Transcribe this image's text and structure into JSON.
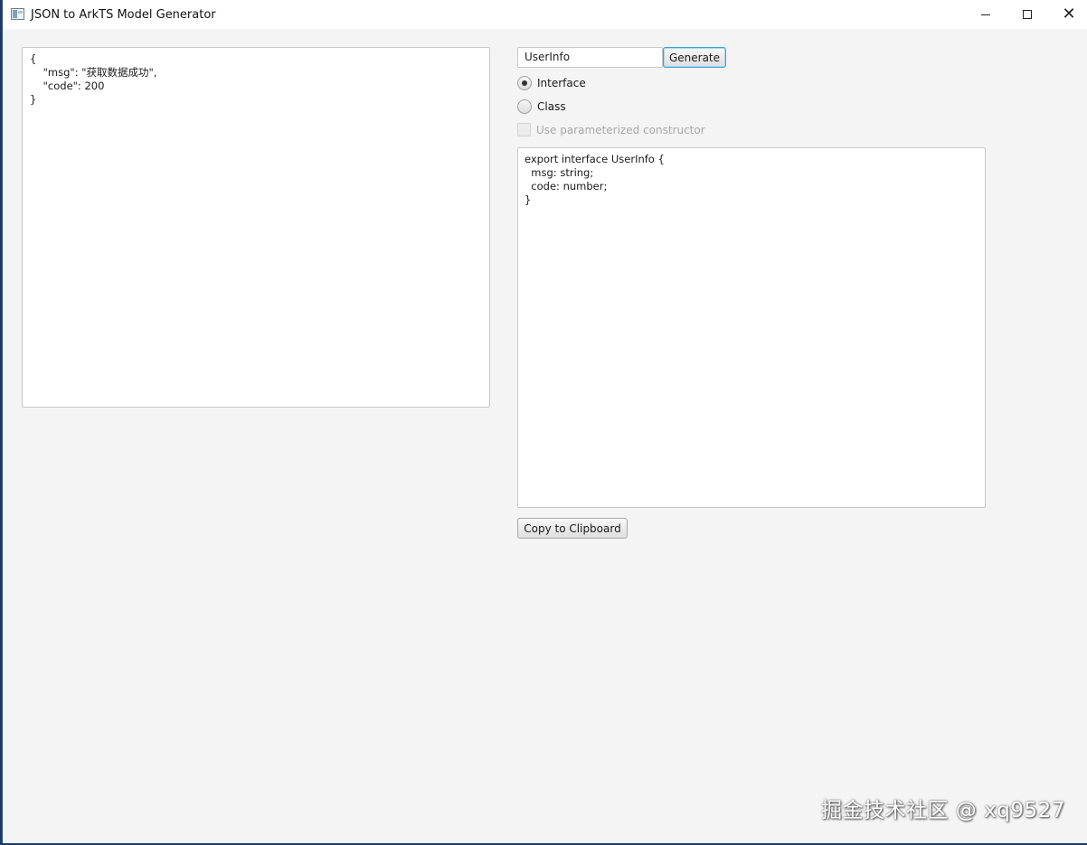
{
  "window": {
    "title": "JSON to ArkTS Model Generator",
    "icons": {
      "app": "app-window-icon",
      "minimize": "minimize-icon",
      "maximize": "maximize-icon",
      "close": "close-icon"
    },
    "close_glyph": "✕"
  },
  "json_input": {
    "value": "{\n    \"msg\": \"获取数据成功\",\n    \"code\": 200\n}"
  },
  "class_name_input": {
    "value": "UserInfo"
  },
  "generate_button": {
    "label": "Generate"
  },
  "type_options": [
    {
      "label": "Interface",
      "selected": true
    },
    {
      "label": "Class",
      "selected": false
    }
  ],
  "constructor_option": {
    "label": "Use parameterized constructor",
    "checked": false,
    "disabled": true
  },
  "output": {
    "value": "export interface UserInfo {\n  msg: string;\n  code: number;\n}"
  },
  "copy_button": {
    "label": "Copy to Clipboard"
  },
  "watermark": "掘金技术社区 @ xq9527",
  "colors": {
    "focus_border": "#3aa0d6",
    "background": "#f4f4f4",
    "disabled_text": "#a8a8a8"
  }
}
